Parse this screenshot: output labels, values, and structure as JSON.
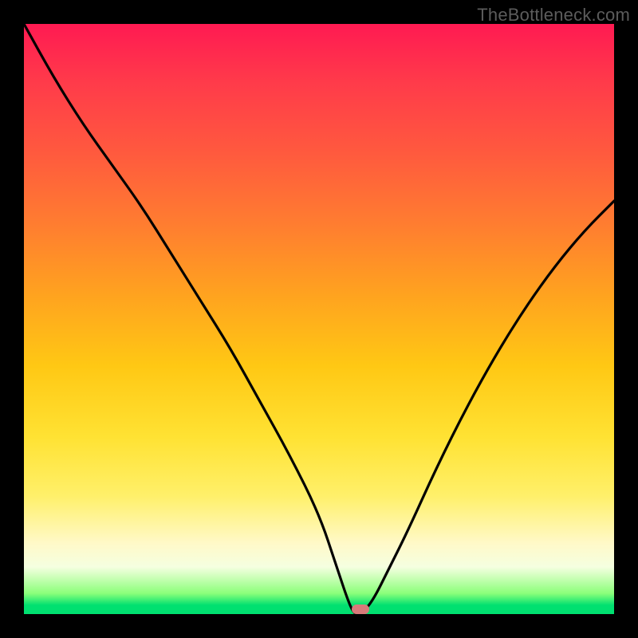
{
  "watermark": "TheBottleneck.com",
  "marker": {
    "x_pct": 57,
    "y_pct": 99.2
  },
  "chart_data": {
    "type": "line",
    "title": "",
    "xlabel": "",
    "ylabel": "",
    "xlim": [
      0,
      100
    ],
    "ylim": [
      0,
      100
    ],
    "grid": false,
    "legend": false,
    "note": "Bottleneck curve: y = bottleneck percentage (100 at top, 0 at bottom). Minimum (≈0%) occurs near x≈56. x/y values are estimates read from an unlabeled gradient chart.",
    "series": [
      {
        "name": "bottleneck-curve",
        "x": [
          0,
          5,
          10,
          15,
          20,
          25,
          30,
          35,
          40,
          45,
          50,
          53,
          55,
          56,
          57,
          59,
          62,
          65,
          70,
          75,
          80,
          85,
          90,
          95,
          100
        ],
        "values": [
          100,
          91,
          83,
          76,
          69,
          61,
          53,
          45,
          36,
          27,
          17,
          8,
          2,
          0,
          0,
          2,
          8,
          14,
          25,
          35,
          44,
          52,
          59,
          65,
          70
        ]
      }
    ],
    "gradient_colors": {
      "top": "#ff1a52",
      "mid": "#ffd11a",
      "bottom": "#00e070"
    }
  }
}
